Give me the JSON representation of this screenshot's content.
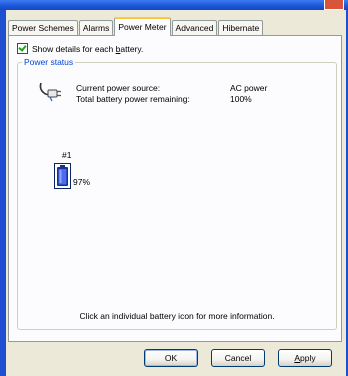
{
  "tabs": [
    "Power Schemes",
    "Alarms",
    "Power Meter",
    "Advanced",
    "Hibernate"
  ],
  "active_tab": "Power Meter",
  "checkbox": {
    "label_prefix": "Show details for each ",
    "label_mnemonic": "b",
    "label_suffix": "attery.",
    "checked": true
  },
  "group": {
    "title": "Power status",
    "source_label": "Current power source:",
    "source_value": "AC power",
    "remaining_label": "Total battery power remaining:",
    "remaining_value": "100%"
  },
  "battery": {
    "number": "#1",
    "percent_label": "97%",
    "level": 0.97,
    "icon": "battery-icon"
  },
  "hint": "Click an individual battery icon for more information.",
  "buttons": {
    "ok": "OK",
    "cancel": "Cancel",
    "apply_mnemonic": "A",
    "apply_rest": "pply"
  },
  "colors": {
    "accent": "#0046d5",
    "tab_highlight": "#ffc83c",
    "titlebar": "#1c55d8"
  }
}
